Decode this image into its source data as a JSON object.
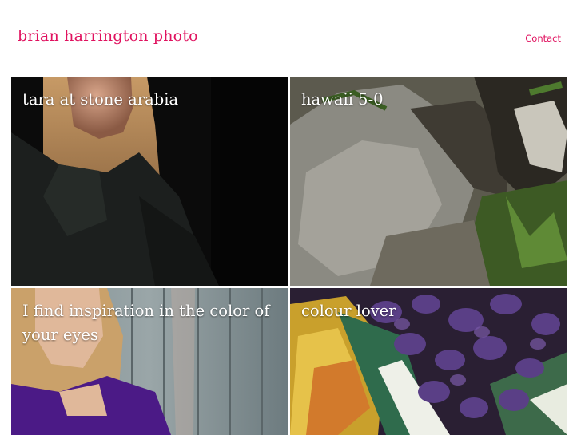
{
  "header": {
    "site_title": "brian harrington photo",
    "contact_label": "Contact",
    "accent_color": "#e0125f"
  },
  "gallery": {
    "items": [
      {
        "caption": "tara at stone arabia"
      },
      {
        "caption": "hawaii 5-0"
      },
      {
        "caption": "I find inspiration in the color of your eyes"
      },
      {
        "caption": "colour lover"
      }
    ]
  }
}
